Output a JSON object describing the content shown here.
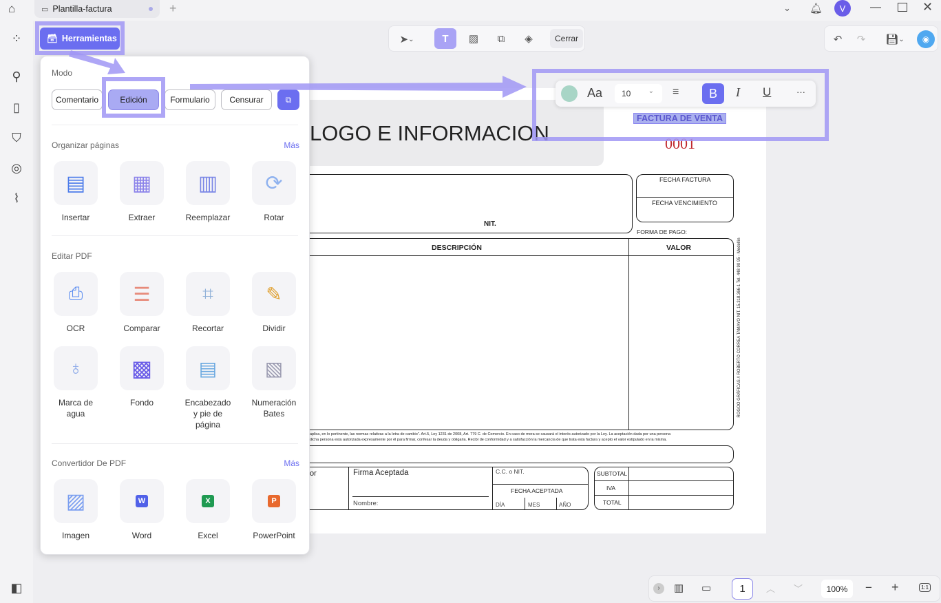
{
  "tab": {
    "title": "Plantilla-factura",
    "avatar": "V"
  },
  "toolbar": {
    "close_label": "Cerrar",
    "tools_label": "Herramientas"
  },
  "format_bar": {
    "color": "#a8d5c6",
    "font_label": "Aa",
    "font_size": "10",
    "bold": "B",
    "italic": "I",
    "underline": "U",
    "more": "···"
  },
  "panel": {
    "mode_title": "Modo",
    "modes": [
      "Comentario",
      "Edición",
      "Formulario",
      "Censurar"
    ],
    "selected_mode": "Edición",
    "sections": [
      {
        "title": "Organizar páginas",
        "more": "Más",
        "tools": [
          "Insertar",
          "Extraer",
          "Reemplazar",
          "Rotar"
        ]
      },
      {
        "title": "Editar PDF",
        "tools": [
          "OCR",
          "Comparar",
          "Recortar",
          "Dividir",
          "Marca de agua",
          "Fondo",
          "Encabezado y pie de página",
          "Numeración Bates"
        ]
      },
      {
        "title": "Convertidor De PDF",
        "more": "Más",
        "tools": [
          "Imagen",
          "Word",
          "Excel",
          "PowerPoint"
        ]
      }
    ]
  },
  "document": {
    "logo_text": "LOGO E INFORMACION",
    "invoice_title": "FACTURA DE VENTA",
    "invoice_number": "0001",
    "fecha_factura": "FECHA FACTURA",
    "fecha_vencimiento": "FECHA VENCIMIENTO",
    "nit": "NIT.",
    "forma_pago": "FORMA DE PAGO:",
    "descripcion": "DESCRIPCIÓN",
    "valor": "VALOR",
    "side_text": "ROGOO GRÁFICAS // ROBERTO CORREA TAMAYO NIT. 15.318.366-1 Tel. 448 90 95 - Medellín",
    "legal_line1": "aplica, en lo pertinente, las normas relativas a la letra de cambio\". Art.5, Ley 1231 de 2008, Art. 779 C. de Comercio.  En caso de mora se causará el interés autorizado por la Ley. La aceptación dada por una persona",
    "legal_line2": "dicha persona esta autorizada expresamente por él para firmar, confesar la deuda y obligarla. Recibí de conformidad y a satisfacción la mercancía de que trata esta factura y acepto el valor estipulado en la misma.",
    "or_text": "or",
    "firma": "Firma Aceptada",
    "nombre": "Nombre:",
    "cc_nit": "C.C. o NIT.",
    "fecha_aceptada": "FECHA  ACEPTADA",
    "dia": "DÍA",
    "mes": "MES",
    "anio": "AÑO",
    "subtotal": "SUBTOTAL",
    "iva": "IVA",
    "total": "TOTAL"
  },
  "bottom": {
    "page": "1",
    "zoom": "100%",
    "fit": "1:1"
  }
}
